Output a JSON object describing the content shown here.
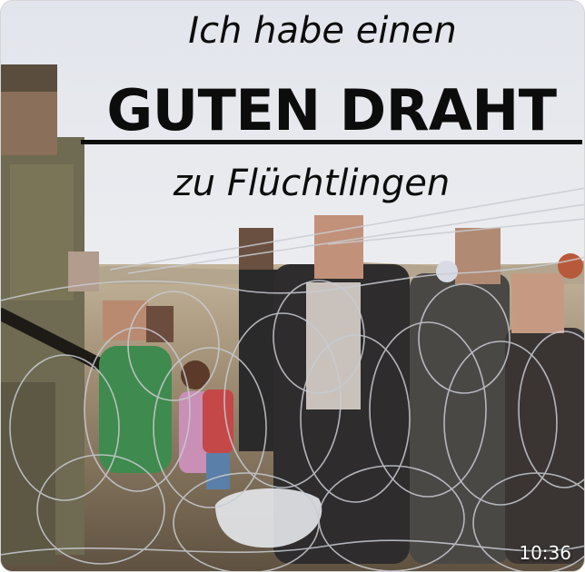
{
  "image": {
    "caption_line1": "Ich habe einen",
    "caption_line2": "GUTEN DRAHT",
    "caption_line3": "zu Flüchtlingen",
    "video_timestamp": "10:36"
  },
  "colors": {
    "sky": "#e6e8ee",
    "ground": "#8e7c64",
    "text": "#0c0c0c",
    "wire": "#c9ccd2"
  }
}
